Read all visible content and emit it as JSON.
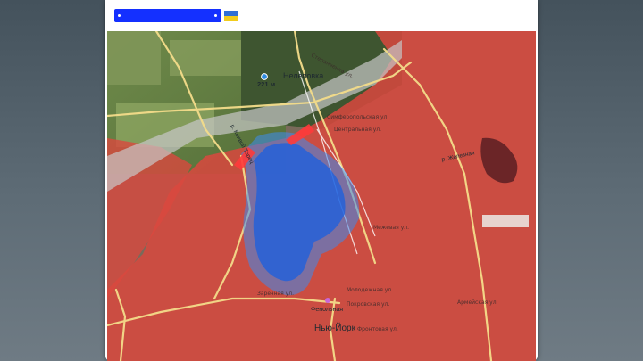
{
  "header": {
    "redacted": true,
    "flag_icon": "ukraine-flag-icon",
    "flag_colors": [
      "#2f6fd6",
      "#f2cc1c"
    ]
  },
  "map": {
    "labels": {
      "village_north": "Нелеповка",
      "city_south": "Нью-Йорк",
      "station": "Фенольная",
      "height_marker": "221 м",
      "river_west": "р. Кривой Торец",
      "river_east": "р. Железная"
    },
    "streets": [
      "Степанченка ул.",
      "Симферопольская ул.",
      "Центральная ул.",
      "Молодежная ул.",
      "Покровская ул.",
      "Заречная ул.",
      "Фронтовая ул.",
      "Межевая ул.",
      "Армейская ул."
    ],
    "colors": {
      "russian_control": "#d9483e",
      "ukrainian_control": "#1a5fe0",
      "gray_zone": "#c8c8c8",
      "road": "#f4dc8a",
      "attack_arrow": "#ff3b3b"
    }
  }
}
